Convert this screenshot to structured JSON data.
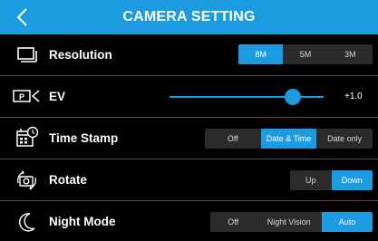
{
  "header": {
    "title": "CAMERA SETTING",
    "back_icon": "chevron-left-icon"
  },
  "colors": {
    "accent": "#1d9be0",
    "background": "#000000",
    "segment_bg": "#2b2b2b",
    "divider": "#4a4a4a"
  },
  "rows": {
    "resolution": {
      "icon": "resolution-icon",
      "label": "Resolution",
      "options": [
        "8M",
        "5M",
        "3M"
      ],
      "selected": "8M"
    },
    "ev": {
      "icon": "ev-icon",
      "label": "EV",
      "value_text": "+1.0",
      "value": 1.0,
      "slider_fraction": 0.8
    },
    "time_stamp": {
      "icon": "calendar-clock-icon",
      "label": "Time Stamp",
      "options": [
        "Off",
        "Date & Time",
        "Date only"
      ],
      "selected": "Date & Time"
    },
    "rotate": {
      "icon": "rotate-camera-icon",
      "label": "Rotate",
      "options": [
        "Up",
        "Down"
      ],
      "selected": "Down"
    },
    "night_mode": {
      "icon": "moon-icon",
      "label": "Night Mode",
      "options": [
        "Off",
        "Night Vision",
        "Auto"
      ],
      "selected": "Auto"
    }
  }
}
